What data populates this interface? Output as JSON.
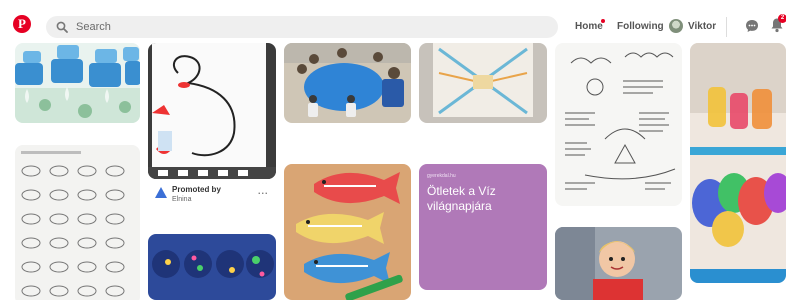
{
  "header": {
    "logo_glyph": "P",
    "search": {
      "placeholder": "Search",
      "icon": "search-icon"
    },
    "nav": {
      "home": "Home",
      "following": "Following",
      "user": "Viktor"
    },
    "notification_badge": "2",
    "icons": [
      "chat-icon",
      "bell-icon"
    ],
    "accent_color": "#e60023"
  },
  "pins": {
    "promoted": {
      "title": "Promoted by",
      "advertiser": "Elnina",
      "more": "..."
    },
    "purple_card": {
      "small_text": "gyerekdal.hu",
      "title": "Ötletek a Víz világnapjára",
      "color": "#b079b8"
    }
  }
}
